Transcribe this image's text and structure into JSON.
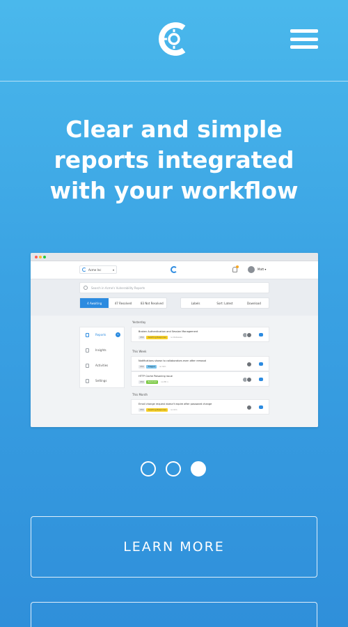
{
  "header": {
    "logo_icon": "brand-c-logo-icon",
    "menu_icon": "hamburger-menu-icon"
  },
  "hero": {
    "headline": "Clear and simple reports integrated with your workflow"
  },
  "screenshot": {
    "org_name": "Acme Inc",
    "user_name": "Matt",
    "search_placeholder": "Search in Acme's Vulnerability Reports",
    "filters": [
      "4 Awaiting",
      "47 Resolved",
      "83 Not Resolved"
    ],
    "sort_controls": [
      "Labels",
      "Sort: Latest",
      "Download"
    ],
    "sidebar": [
      "Reports",
      "Insights",
      "Activities",
      "Settings"
    ],
    "reports_badge": "4",
    "sections": [
      "Yesterday",
      "This Week",
      "This Month"
    ],
    "reports": [
      {
        "title": "Broken Authentication and Session Management",
        "tags": [
          "XSS",
          "Awaiting Response",
          "no Ratewise"
        ],
        "comments": "1"
      },
      {
        "title": "Notifications shown to collaborators even after removal",
        "tags": [
          "XSS",
          "Triaged",
          "no Ibm"
        ],
        "comments": "1"
      },
      {
        "title": "HTTP Cache Poisoning issue",
        "tags": [
          "XSS",
          "Resolved",
          "no PR n"
        ],
        "comments": "1"
      },
      {
        "title": "Email change request doesn't expire after password change",
        "tags": [
          "XSS",
          "Awaiting Response",
          "no Ibm"
        ],
        "comments": "1"
      }
    ]
  },
  "carousel": {
    "count": 3,
    "active_index": 2
  },
  "actions": {
    "learn_more_label": "LEARN MORE",
    "second_label": ""
  },
  "colors": {
    "accent": "#2c8be0",
    "bg_top": "#4ab8ec",
    "bg_bottom": "#2f8fda"
  }
}
